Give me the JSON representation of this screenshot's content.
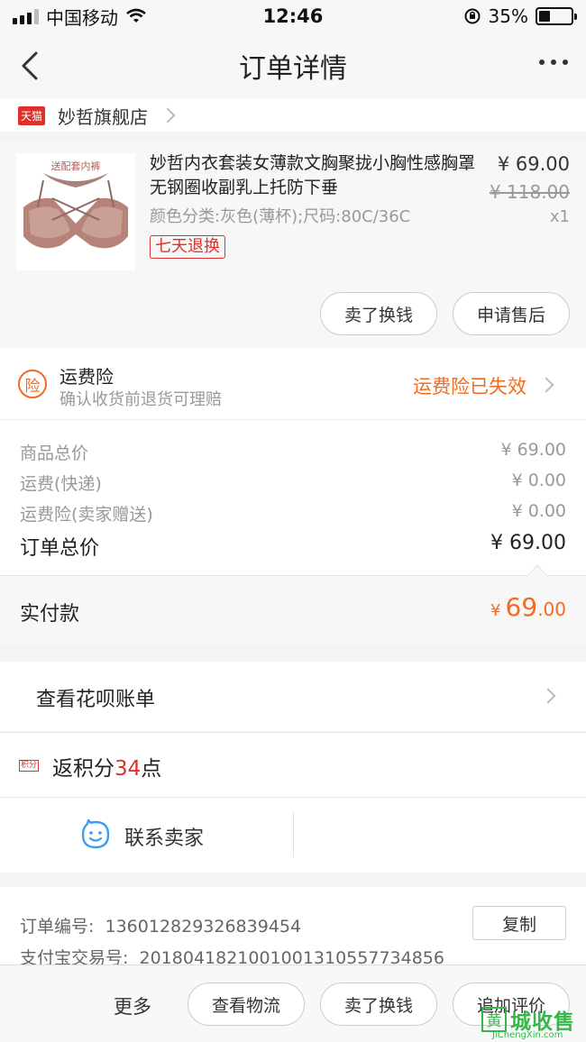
{
  "status_bar": {
    "carrier": "中国移动",
    "time": "12:46",
    "battery": "35%",
    "battery_level": 0.35,
    "icons": [
      "signal-icon",
      "wifi-icon",
      "orientation-lock-icon",
      "battery-icon"
    ]
  },
  "nav": {
    "title": "订单详情",
    "icons": [
      "back-icon",
      "more-icon"
    ]
  },
  "shop": {
    "badge": "天猫",
    "name": "妙哲旗舰店"
  },
  "product": {
    "image_label": "送配套内裤",
    "title": "妙哲内衣套装女薄款文胸聚拢小胸性感胸罩无钢圈收副乳上托防下垂",
    "sku": "颜色分类:灰色(薄杯);尺码:80C/36C",
    "return_tag": "七天退换",
    "price": "¥ 69.00",
    "original_price": "¥ 118.00",
    "quantity": "x1",
    "actions": {
      "sell": "卖了换钱",
      "after_sale": "申请售后"
    }
  },
  "insurance": {
    "icon_char": "险",
    "title": "运费险",
    "subtitle": "确认收货前退货可理赔",
    "status": "运费险已失效"
  },
  "costs": {
    "rows": [
      {
        "label": "商品总价",
        "value": "¥ 69.00"
      },
      {
        "label": "运费(快递)",
        "value": "¥ 0.00"
      },
      {
        "label": "运费险(卖家赠送)",
        "value": "¥ 0.00"
      }
    ],
    "total_label": "订单总价",
    "total_value": "¥ 69.00"
  },
  "paid": {
    "label": "实付款",
    "currency": "¥",
    "integer": "69",
    "decimal": ".00"
  },
  "huabei": {
    "label": "查看花呗账单"
  },
  "points": {
    "badge": "积分",
    "prefix": "返积分",
    "number": "34",
    "suffix": "点"
  },
  "contact": {
    "label": "联系卖家"
  },
  "order_info": {
    "order_no_label": "订单编号:",
    "order_no": "136012829326839454",
    "alipay_label": "支付宝交易号:",
    "alipay_no": "2018041821001001310557734856",
    "copy_label": "复制"
  },
  "bottom_bar": {
    "more": "更多",
    "logistics": "查看物流",
    "sell": "卖了换钱",
    "review": "追加评价"
  },
  "watermark": {
    "box_char": "黄",
    "text": "城收售",
    "url": "JiChengXin.com"
  },
  "colors": {
    "accent_orange": "#f26b21",
    "tmall_red": "#e0302a",
    "contact_blue": "#3d9df0",
    "watermark_green": "#35b84a"
  }
}
